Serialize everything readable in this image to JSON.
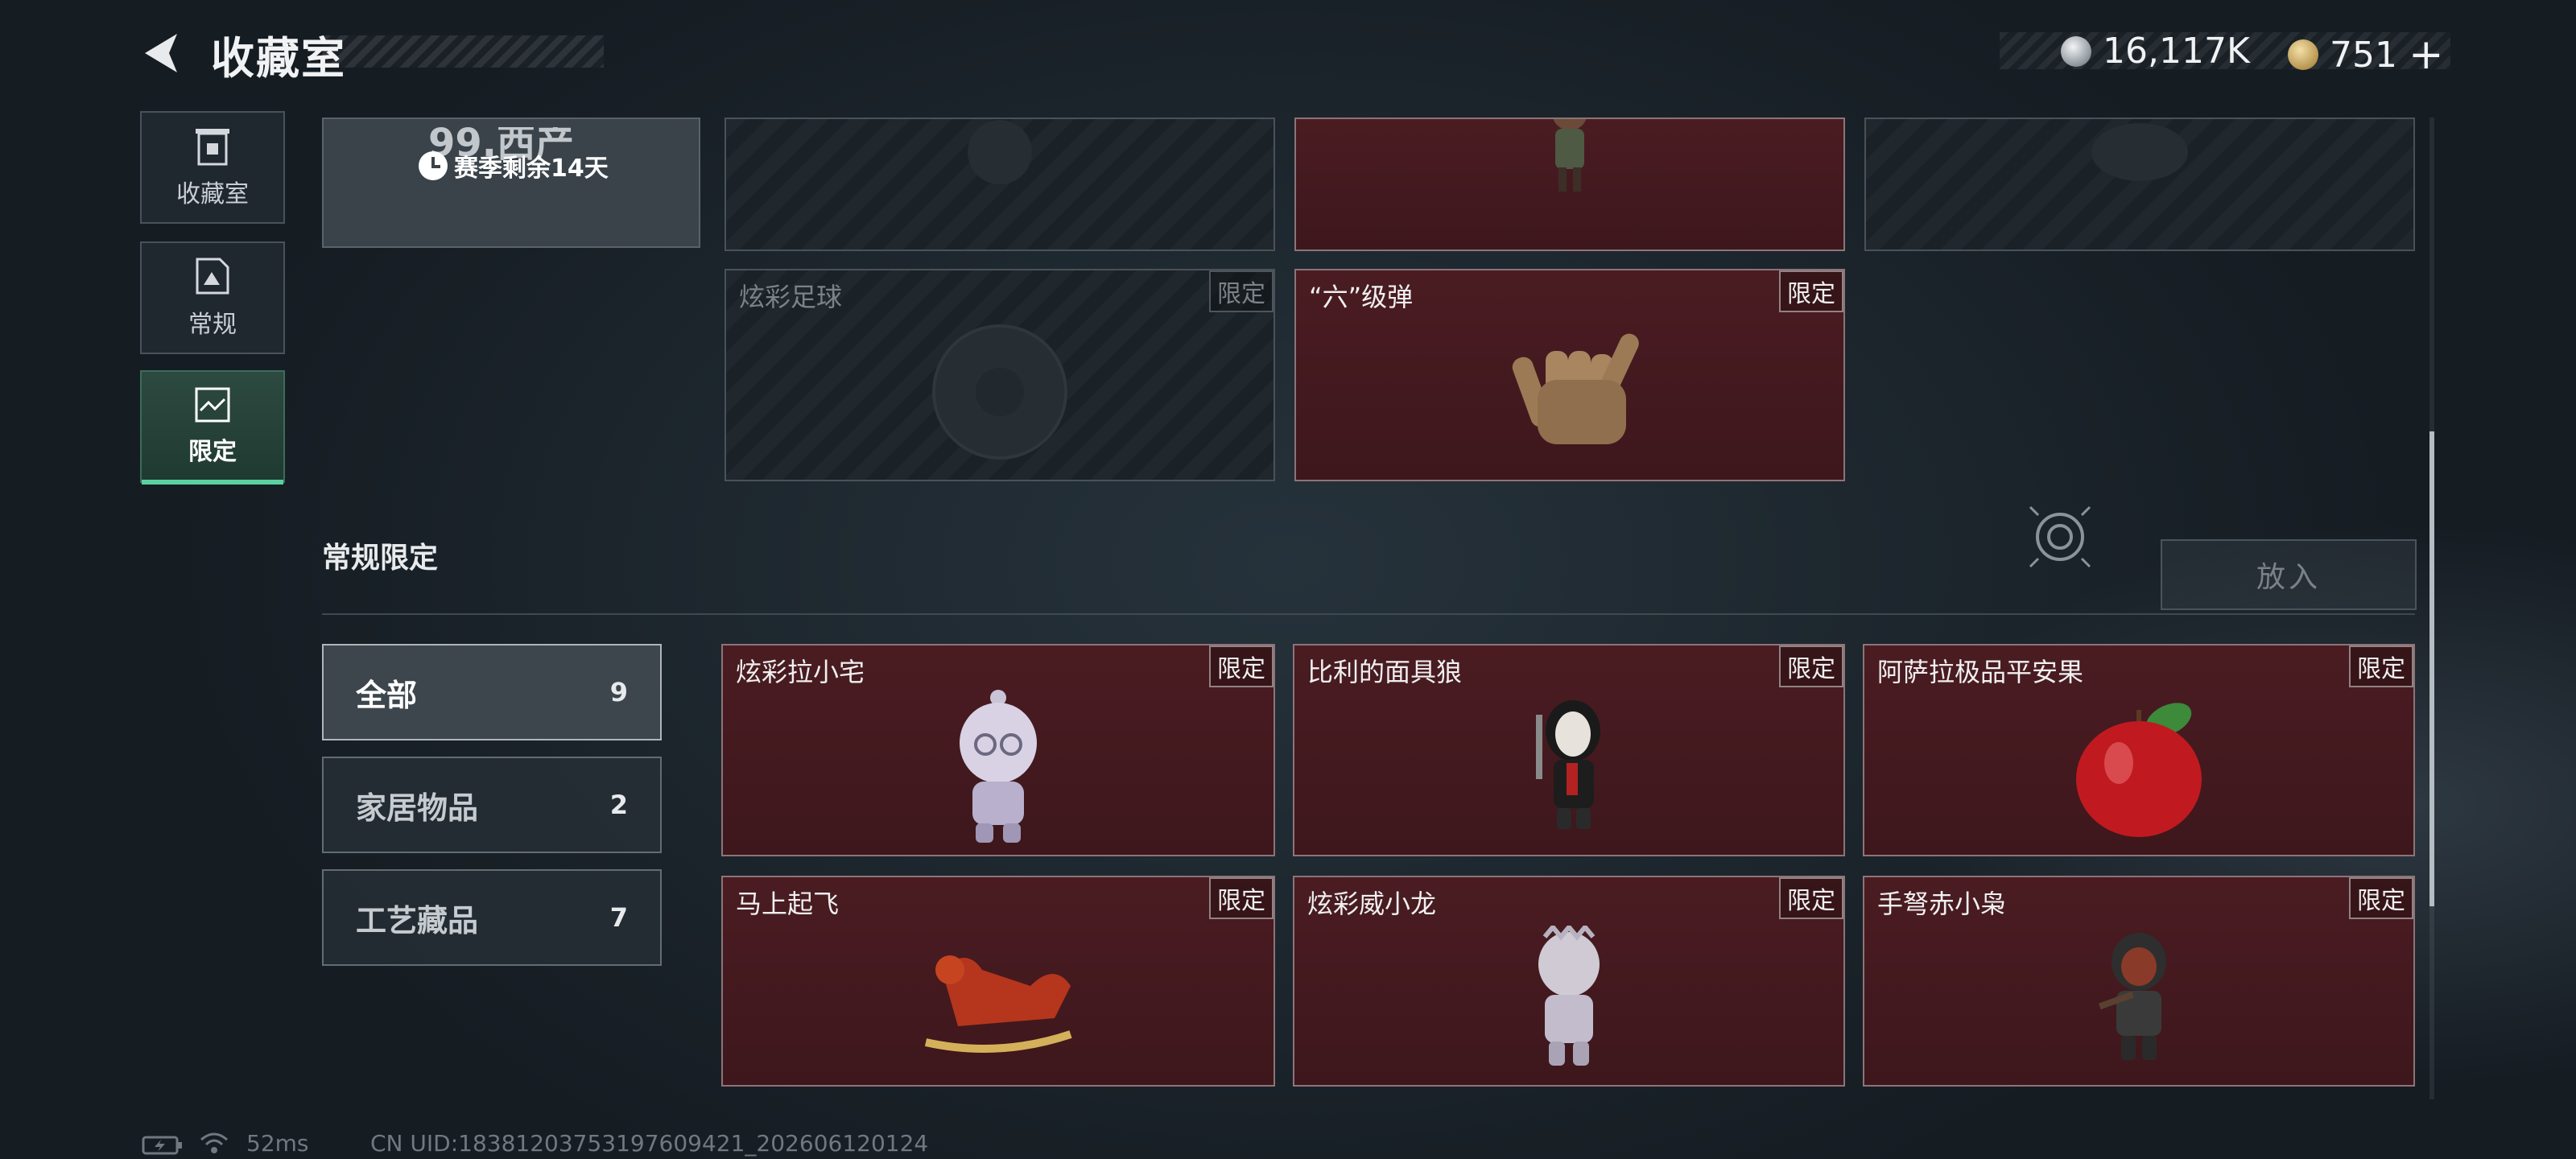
{
  "header": {
    "title": "收藏室"
  },
  "currency": {
    "silver": "16,117K",
    "gold": "751",
    "plus": "+"
  },
  "nav": [
    {
      "label": "收藏室",
      "icon": "trash-bin-icon",
      "active": false
    },
    {
      "label": "常规",
      "icon": "document-icon",
      "active": false
    },
    {
      "label": "限定",
      "icon": "image-frame-icon",
      "active": true
    }
  ],
  "season": {
    "top_partial": "99.西产",
    "timer": "赛季剩余14天"
  },
  "top_cards": [
    {
      "name": "",
      "tag": "",
      "style": "dark"
    },
    {
      "name": "",
      "tag": "",
      "style": "red"
    },
    {
      "name": "",
      "tag": "",
      "style": "dark"
    },
    {
      "name": "炫彩足球",
      "tag": "限定",
      "style": "dark"
    },
    {
      "name": "“六”级弹",
      "tag": "限定",
      "style": "red"
    }
  ],
  "section": {
    "title": "常规限定",
    "put_button": "放入"
  },
  "categories": [
    {
      "label": "全部",
      "count": "9",
      "active": true
    },
    {
      "label": "家居物品",
      "count": "2",
      "active": false
    },
    {
      "label": "工艺藏品",
      "count": "7",
      "active": false
    }
  ],
  "items": [
    {
      "name": "炫彩拉小宅",
      "tag": "限定"
    },
    {
      "name": "比利的面具狼",
      "tag": "限定"
    },
    {
      "name": "阿萨拉极品平安果",
      "tag": "限定"
    },
    {
      "name": "马上起飞",
      "tag": "限定"
    },
    {
      "name": "炫彩威小龙",
      "tag": "限定"
    },
    {
      "name": "手弩赤小枭",
      "tag": "限定"
    }
  ],
  "footer": {
    "ping": "52ms",
    "uid": "CN UID:183812037531976094​21_202606120124"
  },
  "colors": {
    "card_red": "#4a1c22",
    "accent_green": "#5ad2a0",
    "card_border": "#8c7478"
  }
}
